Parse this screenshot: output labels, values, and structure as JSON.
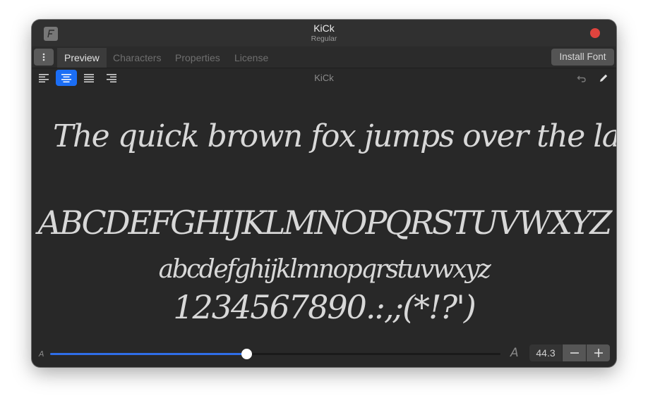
{
  "window": {
    "title": "KiCk",
    "subtitle": "Regular"
  },
  "tabs": [
    {
      "label": "Preview",
      "active": true
    },
    {
      "label": "Characters",
      "active": false
    },
    {
      "label": "Properties",
      "active": false
    },
    {
      "label": "License",
      "active": false
    }
  ],
  "install_button": "Install Font",
  "toolbar": {
    "title": "KiCk",
    "alignment_options": [
      "align-left",
      "align-center",
      "justify",
      "align-right"
    ],
    "selected_alignment": "align-center"
  },
  "preview": {
    "lines": [
      "The quick brown fox jumps over the lazy dog.",
      "ABCDEFGHIJKLMNOPQRSTUVWXYZ",
      "abcdefghijklmnopqrstuvwxyz",
      "1234567890.:,;(*!?')"
    ]
  },
  "size": {
    "small_label": "A",
    "large_label": "A",
    "value": "44.3",
    "slider_fraction": 0.435
  },
  "colors": {
    "accent": "#1b6ef5",
    "close": "#e0443e",
    "background": "#282828"
  }
}
